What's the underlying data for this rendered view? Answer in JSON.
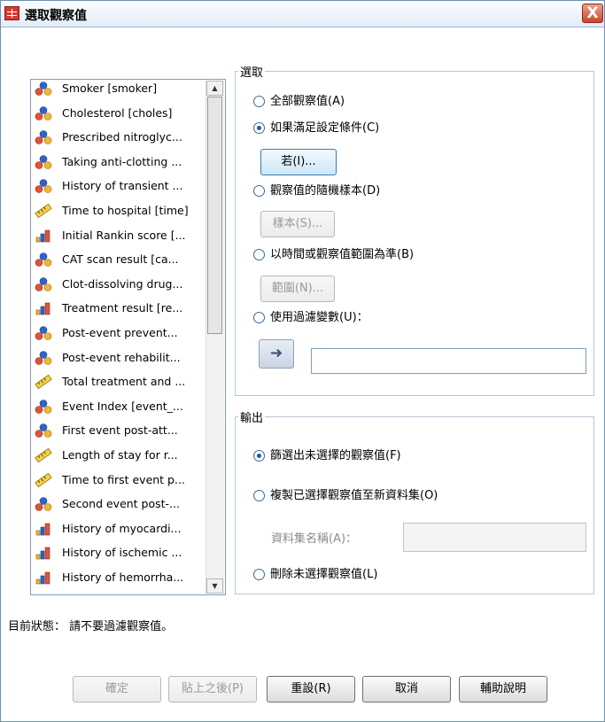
{
  "window": {
    "title": "選取觀察值",
    "close_label": "X"
  },
  "variables": [
    {
      "label": "Smoker [smoker]",
      "icon": "nominal-icon"
    },
    {
      "label": "Cholesterol [choles]",
      "icon": "nominal-icon"
    },
    {
      "label": "Prescribed nitroglyc...",
      "icon": "nominal-icon"
    },
    {
      "label": "Taking anti-clotting ...",
      "icon": "nominal-icon"
    },
    {
      "label": "History of transient ...",
      "icon": "nominal-icon"
    },
    {
      "label": "Time to hospital [time]",
      "icon": "scale-icon"
    },
    {
      "label": "Initial Rankin score [...",
      "icon": "ordinal-icon"
    },
    {
      "label": "CAT scan result [ca...",
      "icon": "nominal-icon"
    },
    {
      "label": "Clot-dissolving drug...",
      "icon": "nominal-icon"
    },
    {
      "label": "Treatment result [re...",
      "icon": "ordinal-icon"
    },
    {
      "label": "Post-event prevent...",
      "icon": "nominal-icon"
    },
    {
      "label": "Post-event rehabilit...",
      "icon": "nominal-icon"
    },
    {
      "label": "Total treatment and ...",
      "icon": "scale-icon"
    },
    {
      "label": "Event Index [event_...",
      "icon": "nominal-icon"
    },
    {
      "label": "First event post-att...",
      "icon": "nominal-icon"
    },
    {
      "label": "Length of stay for r...",
      "icon": "scale-icon"
    },
    {
      "label": "Time to first event p...",
      "icon": "scale-icon"
    },
    {
      "label": "Second event post-...",
      "icon": "nominal-icon"
    },
    {
      "label": "History of myocardi...",
      "icon": "ordinal-icon"
    },
    {
      "label": "History of ischemic ...",
      "icon": "ordinal-icon"
    },
    {
      "label": "History of hemorrha...",
      "icon": "ordinal-icon"
    }
  ],
  "select_group": {
    "title": "選取",
    "all_cases": "全部觀察值(A)",
    "if_condition": "如果滿足設定條件(C)",
    "if_button": "若(I)...",
    "random_sample": "觀察值的隨機樣本(D)",
    "sample_button": "樣本(S)...",
    "range": "以時間或觀察值範圍為準(B)",
    "range_button": "範圍(N)...",
    "filter_var": "使用過濾變數(U)：",
    "filter_value": "",
    "selected": "if_condition"
  },
  "output_group": {
    "title": "輸出",
    "filter_out": "篩選出未選擇的觀察值(F)",
    "copy_new": "複製已選擇觀察值至新資料集(O)",
    "dataset_label": "資料集名稱(A)：",
    "dataset_value": "",
    "delete": "刪除未選擇觀察值(L)",
    "selected": "filter_out"
  },
  "status": "目前狀態：  請不要過濾觀察值。",
  "buttons": {
    "ok": "確定",
    "paste": "貼上之後(P)",
    "reset": "重設(R)",
    "cancel": "取消",
    "help": "輔助說明"
  }
}
